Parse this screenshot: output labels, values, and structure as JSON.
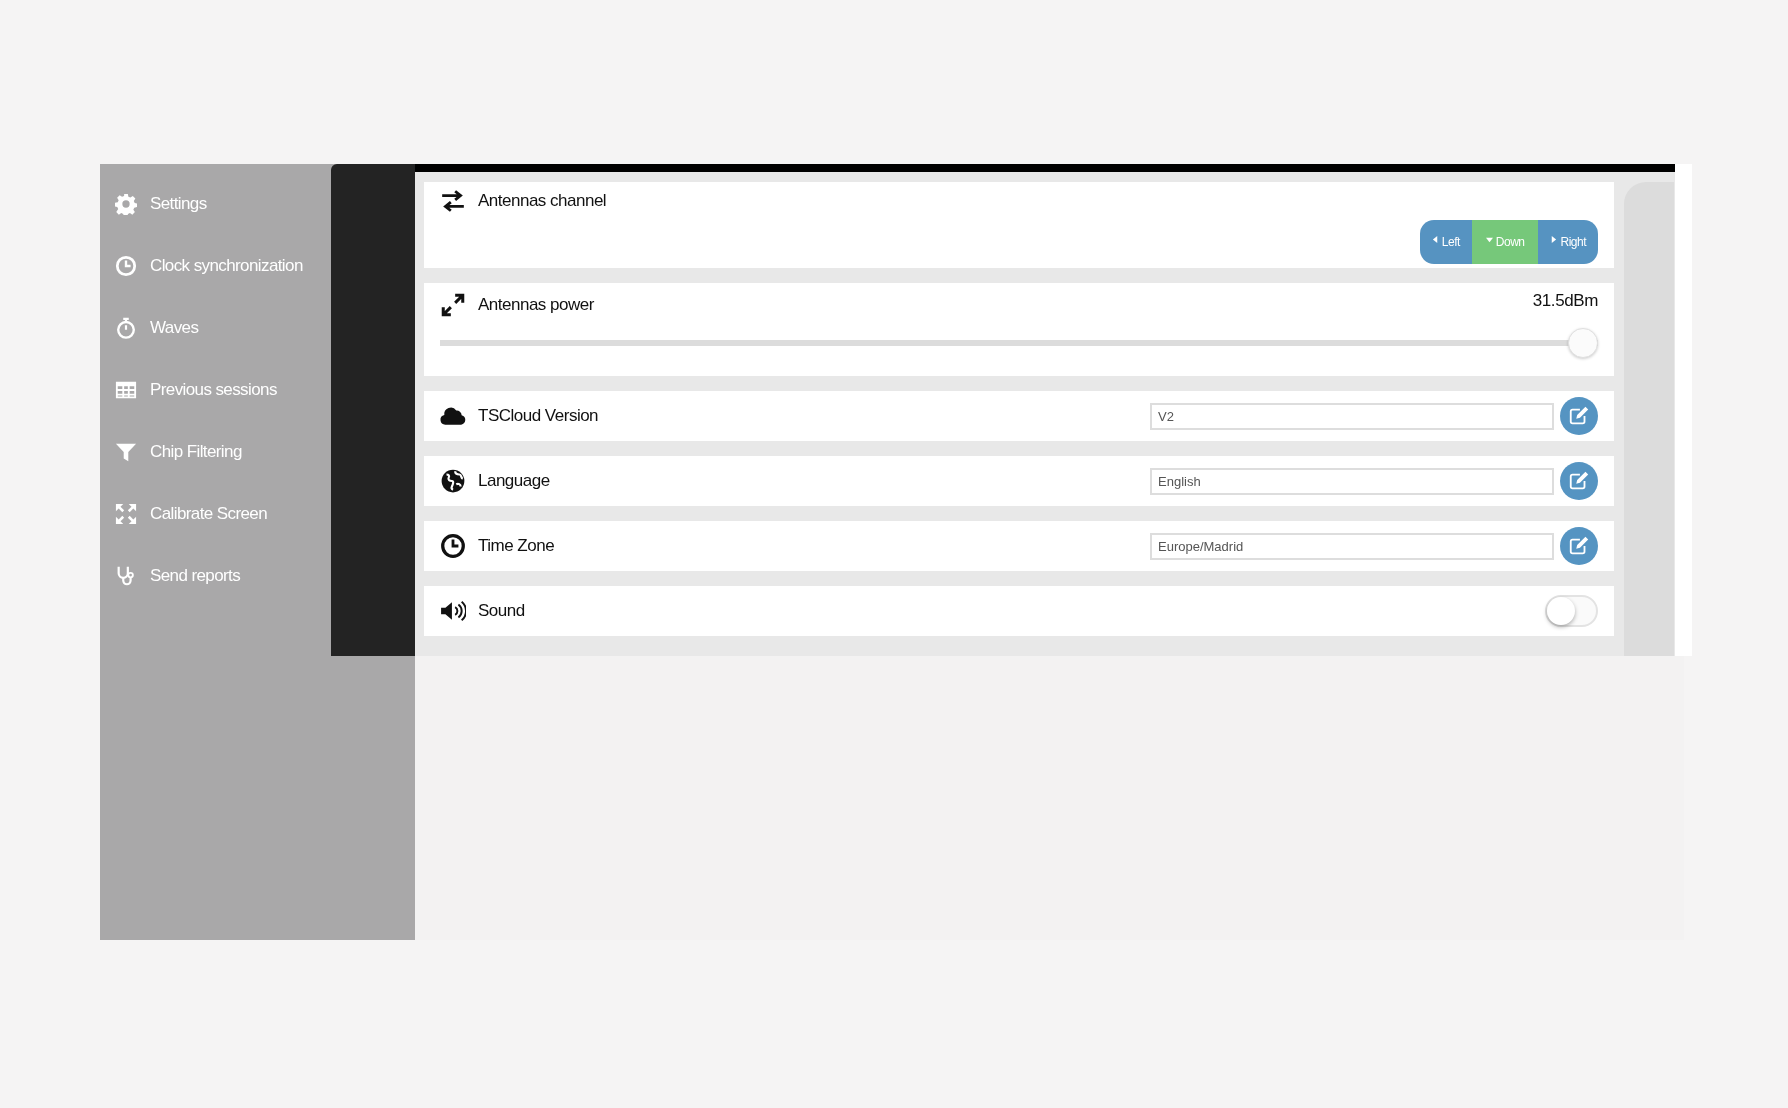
{
  "sidebar": {
    "items": [
      {
        "label": "Settings"
      },
      {
        "label": "Clock synchronization"
      },
      {
        "label": "Waves"
      },
      {
        "label": "Previous sessions"
      },
      {
        "label": "Chip Filtering"
      },
      {
        "label": "Calibrate Screen"
      },
      {
        "label": "Send reports"
      }
    ]
  },
  "settings": [
    {
      "kind": "direction",
      "label": "Antennas channel",
      "options": [
        {
          "label": "Left",
          "selected": false
        },
        {
          "label": "Down",
          "selected": true
        },
        {
          "label": "Right",
          "selected": false
        }
      ]
    },
    {
      "kind": "slider",
      "label": "Antennas power",
      "reading": "31.5dBm",
      "level": 1
    },
    {
      "kind": "field",
      "label": "TSCloud Version",
      "value": "V2"
    },
    {
      "kind": "field",
      "label": "Language",
      "value": "English"
    },
    {
      "kind": "field",
      "label": "Time Zone",
      "value": "Europe/Madrid"
    },
    {
      "kind": "toggle",
      "label": "Sound",
      "on": false
    }
  ]
}
